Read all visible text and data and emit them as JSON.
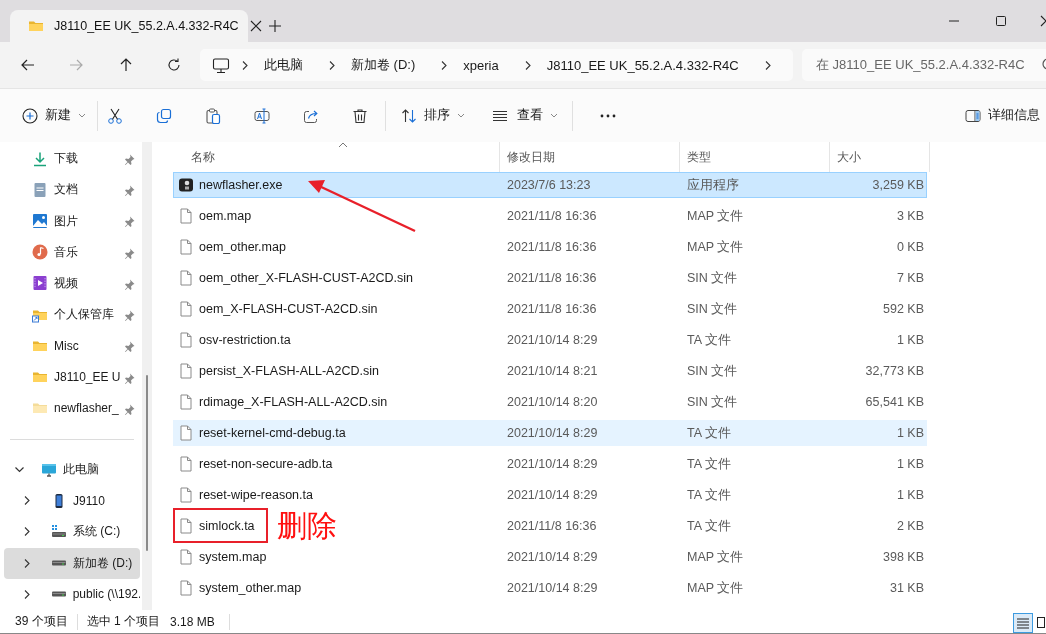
{
  "window": {
    "tab_title": "J8110_EE UK_55.2.A.4.332-R4C"
  },
  "address": {
    "crumbs": [
      "此电脑",
      "新加卷 (D:)",
      "xperia",
      "J8110_EE UK_55.2.A.4.332-R4C"
    ]
  },
  "search": {
    "placeholder": "在 J8110_EE UK_55.2.A.4.332-R4C"
  },
  "toolbar": {
    "new_label": "新建",
    "sort_label": "排序",
    "view_label": "查看",
    "details_label": "详细信息"
  },
  "sidebar": {
    "pinned": [
      {
        "label": "下载",
        "kind": "downloads"
      },
      {
        "label": "文档",
        "kind": "documents"
      },
      {
        "label": "图片",
        "kind": "pictures"
      },
      {
        "label": "音乐",
        "kind": "music"
      },
      {
        "label": "视频",
        "kind": "videos"
      },
      {
        "label": "个人保管库",
        "kind": "vault"
      },
      {
        "label": "Misc",
        "kind": "folder"
      },
      {
        "label": "J8110_EE U",
        "kind": "folder"
      },
      {
        "label": "newflasher_",
        "kind": "folder_light"
      }
    ],
    "tree": [
      {
        "label": "此电脑",
        "kind": "computer",
        "expanded": true,
        "selected": false,
        "children": [
          {
            "label": "J9110",
            "kind": "phone",
            "expanded": false,
            "selected": false
          },
          {
            "label": "系统 (C:)",
            "kind": "system_drive",
            "expanded": false,
            "selected": false
          },
          {
            "label": "新加卷 (D:)",
            "kind": "drive",
            "expanded": false,
            "selected": true
          },
          {
            "label": "public (\\\\192.",
            "kind": "drive",
            "expanded": false,
            "selected": false
          }
        ]
      }
    ]
  },
  "table": {
    "columns": [
      "名称",
      "修改日期",
      "类型",
      "大小"
    ],
    "rows": [
      {
        "name": "newflasher.exe",
        "kind": "exe",
        "date": "2023/7/6 13:23",
        "type": "应用程序",
        "size": "3,259 KB",
        "selected": true,
        "hovered": false,
        "arrow_pointed": true
      },
      {
        "name": "oem.map",
        "kind": "file",
        "date": "2021/11/8 16:36",
        "type": "MAP 文件",
        "size": "3 KB",
        "selected": false,
        "hovered": false
      },
      {
        "name": "oem_other.map",
        "kind": "file",
        "date": "2021/11/8 16:36",
        "type": "MAP 文件",
        "size": "0 KB",
        "selected": false,
        "hovered": false
      },
      {
        "name": "oem_other_X-FLASH-CUST-A2CD.sin",
        "kind": "file",
        "date": "2021/11/8 16:36",
        "type": "SIN 文件",
        "size": "7 KB",
        "selected": false,
        "hovered": false
      },
      {
        "name": "oem_X-FLASH-CUST-A2CD.sin",
        "kind": "file",
        "date": "2021/11/8 16:36",
        "type": "SIN 文件",
        "size": "592 KB",
        "selected": false,
        "hovered": false
      },
      {
        "name": "osv-restriction.ta",
        "kind": "file",
        "date": "2021/10/14 8:29",
        "type": "TA 文件",
        "size": "1 KB",
        "selected": false,
        "hovered": false
      },
      {
        "name": "persist_X-FLASH-ALL-A2CD.sin",
        "kind": "file",
        "date": "2021/10/14 8:21",
        "type": "SIN 文件",
        "size": "32,773 KB",
        "selected": false,
        "hovered": false
      },
      {
        "name": "rdimage_X-FLASH-ALL-A2CD.sin",
        "kind": "file",
        "date": "2021/10/14 8:20",
        "type": "SIN 文件",
        "size": "65,541 KB",
        "selected": false,
        "hovered": false
      },
      {
        "name": "reset-kernel-cmd-debug.ta",
        "kind": "file",
        "date": "2021/10/14 8:29",
        "type": "TA 文件",
        "size": "1 KB",
        "selected": false,
        "hovered": true
      },
      {
        "name": "reset-non-secure-adb.ta",
        "kind": "file",
        "date": "2021/10/14 8:29",
        "type": "TA 文件",
        "size": "1 KB",
        "selected": false,
        "hovered": false
      },
      {
        "name": "reset-wipe-reason.ta",
        "kind": "file",
        "date": "2021/10/14 8:29",
        "type": "TA 文件",
        "size": "1 KB",
        "selected": false,
        "hovered": false
      },
      {
        "name": "simlock.ta",
        "kind": "file",
        "date": "2021/11/8 16:36",
        "type": "TA 文件",
        "size": "2 KB",
        "selected": false,
        "hovered": false,
        "boxed": true,
        "note": "删除"
      },
      {
        "name": "system.map",
        "kind": "file",
        "date": "2021/10/14 8:29",
        "type": "MAP 文件",
        "size": "398 KB",
        "selected": false,
        "hovered": false
      },
      {
        "name": "system_other.map",
        "kind": "file",
        "date": "2021/10/14 8:29",
        "type": "MAP 文件",
        "size": "31 KB",
        "selected": false,
        "hovered": false
      }
    ]
  },
  "status_bar": {
    "item_count": "39 个项目",
    "selection": "选中 1 个项目",
    "selection_size": "3.18 MB",
    "views": [
      {
        "kind": "details",
        "selected": true
      },
      {
        "kind": "tiles",
        "selected": false
      }
    ]
  }
}
